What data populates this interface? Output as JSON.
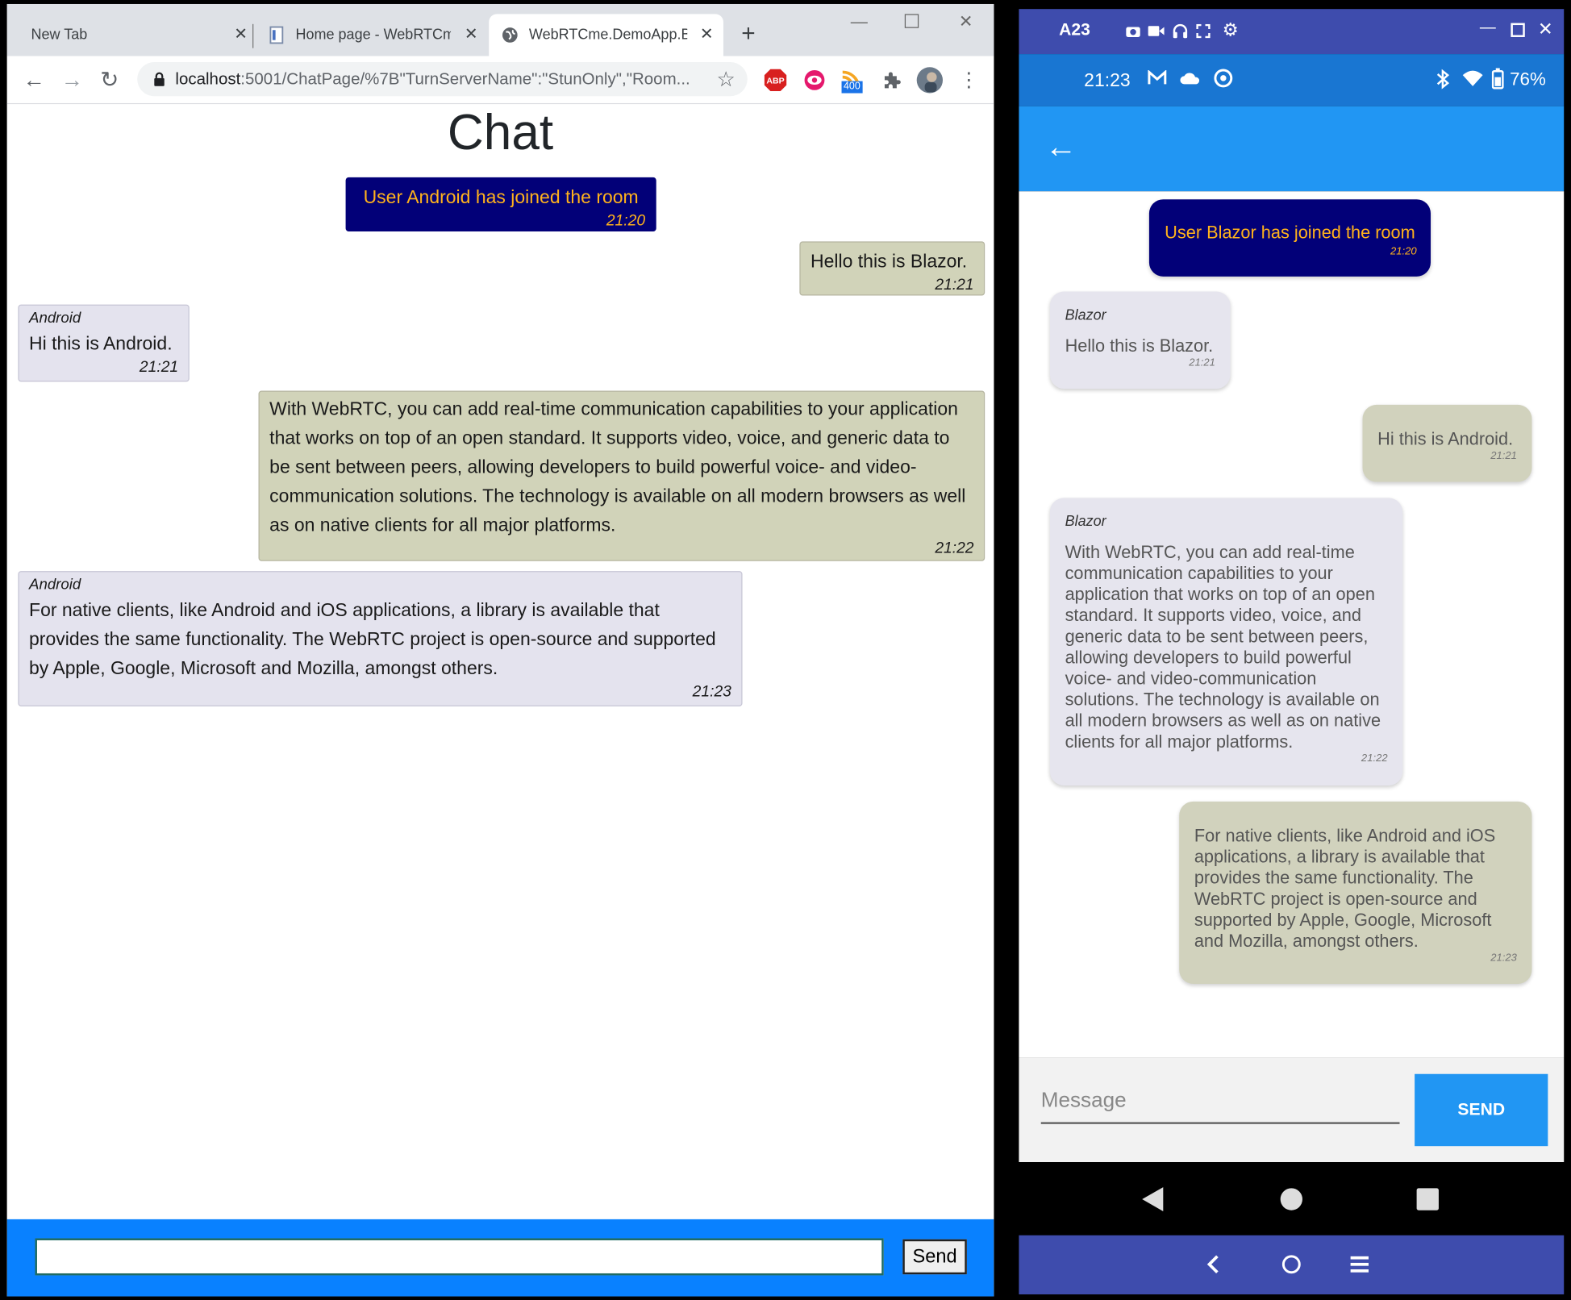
{
  "browser": {
    "tabs": [
      {
        "label": "New Tab"
      },
      {
        "label": "Home page - WebRTCme"
      },
      {
        "label": "WebRTCme.DemoApp.Blazor"
      }
    ],
    "url_host": "localhost",
    "url_path": ":5001/ChatPage/%7B\"TurnServerName\":\"StunOnly\",\"Room...",
    "extension_badge": "400",
    "abp_label": "ABP"
  },
  "web_chat": {
    "title": "Chat",
    "messages": [
      {
        "text": "User Android has joined the room",
        "time": "21:20"
      },
      {
        "text": "Hello this is Blazor.",
        "time": "21:21"
      },
      {
        "sender": "Android",
        "text": "Hi this is Android.",
        "time": "21:21"
      },
      {
        "text": "With WebRTC, you can add real-time communication capabilities to your application that works on top of an open standard. It supports video, voice, and generic data to be sent between peers, allowing developers to build powerful voice- and video-communication solutions. The technology is available on all modern browsers as well as on native clients for all major platforms.",
        "time": "21:22"
      },
      {
        "sender": "Android",
        "text": "For native clients, like Android and iOS applications, a library is available that provides the same functionality. The WebRTC project is open-source and supported by Apple, Google, Microsoft and Mozilla, amongst others.",
        "time": "21:23"
      }
    ],
    "input_value": "",
    "send_label": "Send"
  },
  "emulator": {
    "device_name": "A23",
    "clock": "21:23",
    "battery": "76%",
    "messages": [
      {
        "text": "User Blazor has joined the room",
        "time": "21:20"
      },
      {
        "sender": "Blazor",
        "text": "Hello this is Blazor.",
        "time": "21:21"
      },
      {
        "text": "Hi this is Android.",
        "time": "21:21"
      },
      {
        "sender": "Blazor",
        "text": "With WebRTC, you can add real-time communication capabilities to your application that works on top of an open standard. It supports video, voice, and generic data to be sent between peers, allowing developers to build powerful voice- and video-communication solutions. The technology is available on all modern browsers as well as on native clients for all major platforms.",
        "time": "21:22"
      },
      {
        "text": "For native clients, like Android and iOS applications, a library is available that provides the same functionality. The WebRTC project is open-source and supported by Apple, Google, Microsoft and Mozilla, amongst others.",
        "time": "21:23"
      }
    ],
    "input_placeholder": "Message",
    "send_label": "SEND"
  },
  "colors": {
    "system_bubble_bg": "#020078",
    "system_bubble_text": "#ffb21c",
    "mine_bubble_bg": "#d1d3b9",
    "theirs_bubble_bg": "#e4e3ee",
    "accent_blue": "#2196f3",
    "footer_blue": "#0981ff"
  }
}
